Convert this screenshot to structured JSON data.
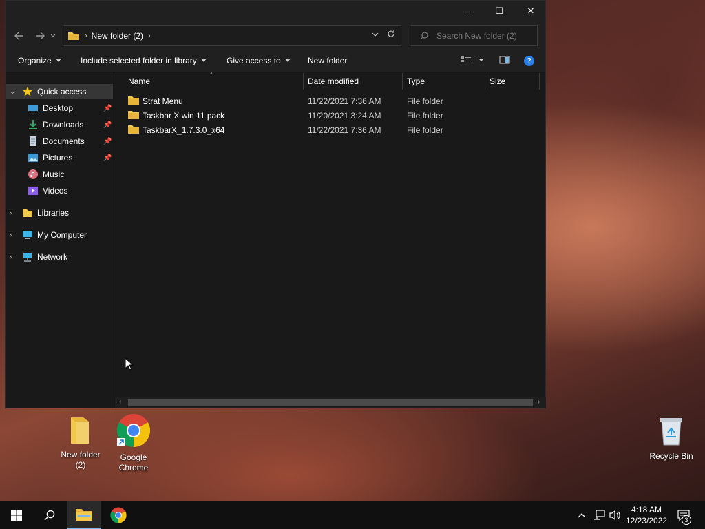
{
  "window": {
    "caption_min": "—",
    "caption_max": "☐",
    "caption_close": "✕"
  },
  "address": {
    "crumb": "New folder (2)",
    "search_placeholder": "Search New folder (2)"
  },
  "commands": {
    "organize": "Organize",
    "include": "Include selected folder in library",
    "give_access": "Give access to",
    "new_folder": "New folder"
  },
  "nav": {
    "quick_access": "Quick access",
    "desktop": "Desktop",
    "downloads": "Downloads",
    "documents": "Documents",
    "pictures": "Pictures",
    "music": "Music",
    "videos": "Videos",
    "libraries": "Libraries",
    "my_computer": "My Computer",
    "network": "Network"
  },
  "columns": {
    "name": "Name",
    "date": "Date modified",
    "type": "Type",
    "size": "Size"
  },
  "files": [
    {
      "name": "Strat Menu",
      "date": "11/22/2021 7:36 AM",
      "type": "File folder"
    },
    {
      "name": "Taskbar X win 11 pack",
      "date": "11/20/2021 3:24 AM",
      "type": "File folder"
    },
    {
      "name": "TaskbarX_1.7.3.0_x64",
      "date": "11/22/2021 7:36 AM",
      "type": "File folder"
    }
  ],
  "desktop": {
    "folder_line1": "New folder",
    "folder_line2": "(2)",
    "chrome_line1": "Google",
    "chrome_line2": "Chrome",
    "recycle": "Recycle Bin"
  },
  "taskbar": {
    "time": "4:18 AM",
    "date": "12/23/2022",
    "notification_count": "3"
  },
  "colors": {
    "folder": "#f2c94c",
    "accent": "#76b9ed",
    "help": "#2b7de9"
  }
}
